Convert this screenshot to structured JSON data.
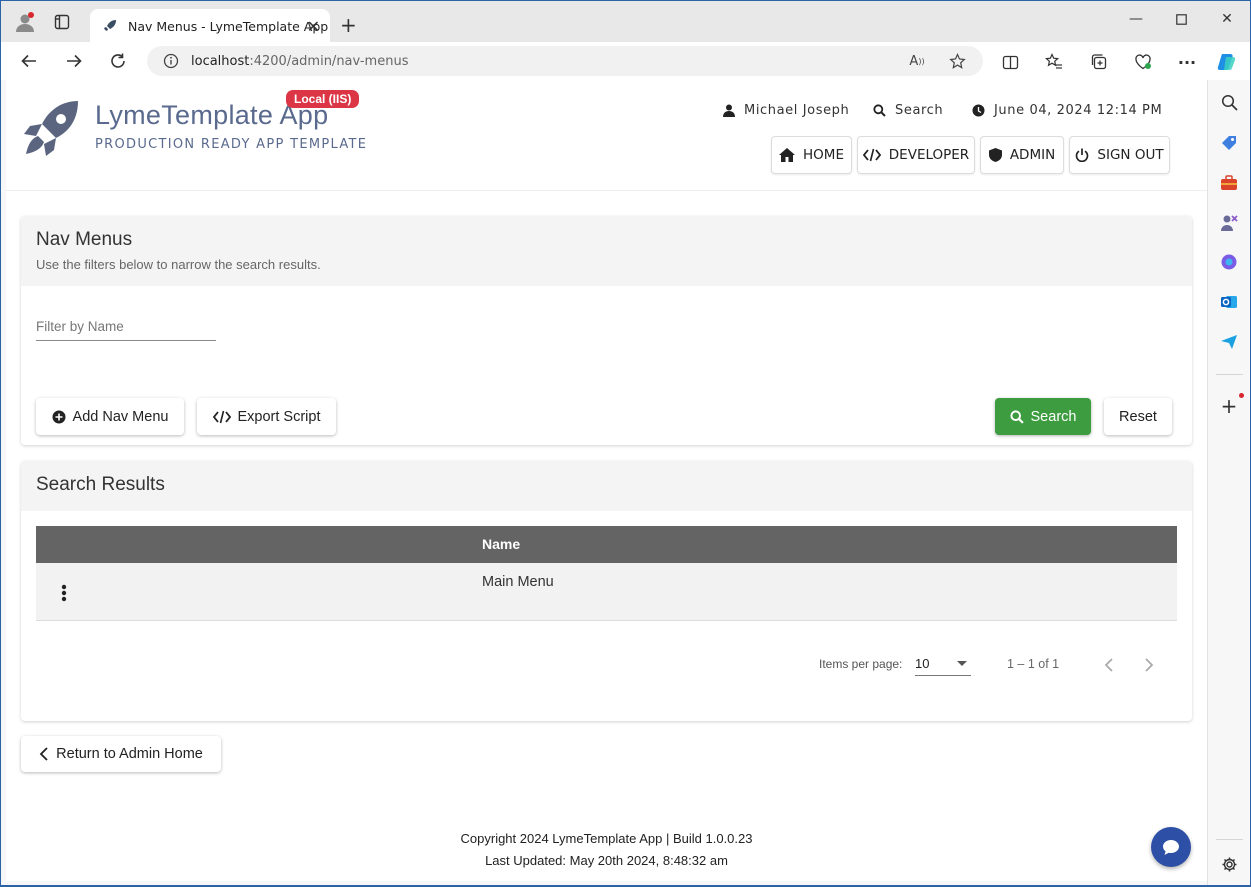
{
  "browser": {
    "tab_title": "Nav Menus - LymeTemplate App",
    "url_host": "localhost",
    "url_rest": ":4200/admin/nav-menus"
  },
  "header": {
    "app_title": "LymeTemplate App",
    "app_subtitle": "PRODUCTION READY APP TEMPLATE",
    "env_badge": "Local (IIS)",
    "user_name": "Michael Joseph",
    "search_label": "Search",
    "datetime": "June 04, 2024 12:14 PM",
    "nav": [
      {
        "label": "HOME",
        "icon": "home-icon"
      },
      {
        "label": "DEVELOPER",
        "icon": "code-icon"
      },
      {
        "label": "ADMIN",
        "icon": "shield-icon"
      },
      {
        "label": "SIGN OUT",
        "icon": "power-icon"
      }
    ]
  },
  "filter_card": {
    "title": "Nav Menus",
    "subtitle": "Use the filters below to narrow the search results.",
    "filter_placeholder": "Filter by Name",
    "filter_value": "",
    "add_label": "Add Nav Menu",
    "export_label": "Export Script",
    "search_label": "Search",
    "reset_label": "Reset"
  },
  "results_card": {
    "title": "Search Results",
    "columns": [
      "",
      "Name"
    ],
    "rows": [
      {
        "name": "Main Menu"
      }
    ],
    "paginator": {
      "items_per_page_label": "Items per page:",
      "page_size": "10",
      "range": "1 – 1 of 1"
    }
  },
  "return_label": "Return to Admin Home",
  "footer": {
    "line1": "Copyright 2024 LymeTemplate App | Build 1.0.0.23",
    "line2": "Last Updated: May 20th 2024, 8:48:32 am"
  },
  "colors": {
    "brand": "#5a6a8e",
    "badge": "#dc3545",
    "search_button": "#3d9c3f",
    "table_header": "#646464",
    "chat_button": "#2d4fa5"
  }
}
